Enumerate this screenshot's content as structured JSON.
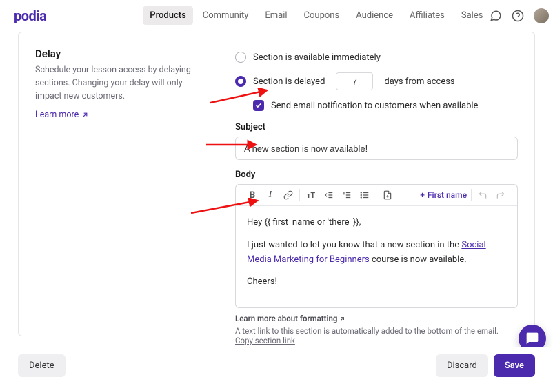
{
  "brand": "podia",
  "nav": {
    "products": "Products",
    "community": "Community",
    "email": "Email",
    "coupons": "Coupons",
    "audience": "Audience",
    "affiliates": "Affiliates",
    "sales": "Sales"
  },
  "section": {
    "title": "Delay",
    "description": "Schedule your lesson access by delaying sections. Changing your delay will only impact new customers.",
    "learn_more": "Learn more"
  },
  "delay": {
    "immediate_label": "Section is available immediately",
    "delayed_prefix": "Section is delayed",
    "days_value": "7",
    "delayed_suffix": "days from access",
    "email_checkbox_label": "Send email notification to customers when available"
  },
  "email": {
    "subject_label": "Subject",
    "subject_value": "A new section is now available!",
    "body_label": "Body",
    "insert_firstname": "First name",
    "body_line1": "Hey {{ first_name or 'there' }},",
    "body_line2_pre": "I just wanted to let you know that a new section in the ",
    "body_link_text": "Social Media Marketing for Beginners",
    "body_line2_post": " course is now available.",
    "body_line3": "Cheers!"
  },
  "hints": {
    "formatting": "Learn more about formatting",
    "autolink_pre": "A text link to this section is automatically added to the bottom of the email. ",
    "copy_link": "Copy section link"
  },
  "buttons": {
    "delete": "Delete",
    "discard": "Discard",
    "save": "Save"
  }
}
